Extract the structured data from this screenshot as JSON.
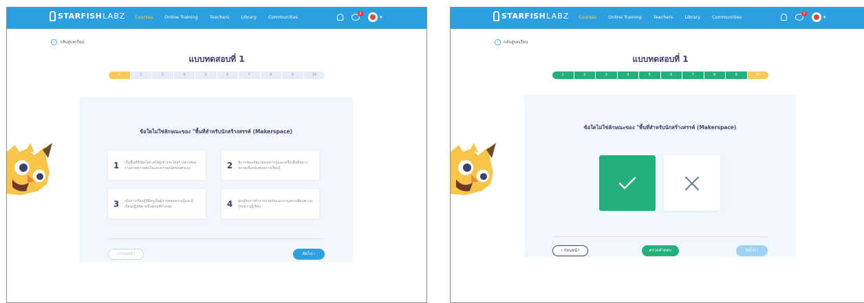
{
  "nav": {
    "logo_main": "STARFISH",
    "logo_sub": "LABZ",
    "menu": [
      {
        "label": "Courses",
        "active": true
      },
      {
        "label": "Online Training",
        "active": false
      },
      {
        "label": "Teachers",
        "active": false
      },
      {
        "label": "Library",
        "active": false
      },
      {
        "label": "Communities",
        "active": false
      }
    ],
    "notification_count": "2",
    "icons": [
      "bell-icon",
      "chat-icon",
      "avatar",
      "chevron-down-icon"
    ]
  },
  "left": {
    "back_label": "กลับสู่บทเรียน",
    "title": "แบบทดสอบที่ 1",
    "progress": {
      "total": 10,
      "current": 1,
      "labels": [
        "1",
        "2",
        "3",
        "4",
        "5",
        "6",
        "7",
        "8",
        "9",
        "10"
      ]
    },
    "question": "ข้อใดไม่ใช่ลักษณะของ \"พื้นที่สำหรับนักสร้างสรรค์ (Makerspace)",
    "options": [
      {
        "num": "1",
        "text": "เป็นพื้นที่ที่เปิดโอกาสให้ผู้เข้าร่วมได้สร้างสรรค์ผลงานตามความสนใจและความถนัดของตนเอง"
      },
      {
        "num": "2",
        "text": "มีการจัดเตรียมวัสดุอุปกรณ์และเครื่องมือที่หลากหลายเพื่อสนับสนุนการเรียนรู้"
      },
      {
        "num": "3",
        "text": "เน้นการเรียนรู้ที่มีครูเป็นผู้ถ่ายทอดความรู้และผู้เรียนปฏิบัติตามขั้นตอนที่กำหนด"
      },
      {
        "num": "4",
        "text": "ส่งเสริมการทำงานร่วมกันและการแลกเปลี่ยนความรู้ระหว่างผู้เรียน"
      }
    ],
    "prev_label": "‹ ก่อนหน้า",
    "next_label": "ถัดไป ›"
  },
  "right": {
    "back_label": "กลับสู่บทเรียน",
    "title": "แบบทดสอบที่ 1",
    "progress": {
      "total": 10,
      "current": 10,
      "labels": [
        "1",
        "2",
        "3",
        "4",
        "5",
        "6",
        "7",
        "8",
        "9",
        "10"
      ]
    },
    "question": "ข้อใดไม่ใช่ลักษณะของ \"พื้นที่สำหรับนักสร้างสรรค์ (Makerspace)",
    "true_icon": "check-icon",
    "false_icon": "close-icon",
    "prev_label": "‹ ก่อนหน้า",
    "submit_label": "ตรวจคำตอบ",
    "next_label": "ถัดไป ›"
  },
  "colors": {
    "nav": "#2b9fe0",
    "current_step": "#fbc85a",
    "done_step": "#23b07b",
    "accent_blue": "#2f9fe0"
  }
}
